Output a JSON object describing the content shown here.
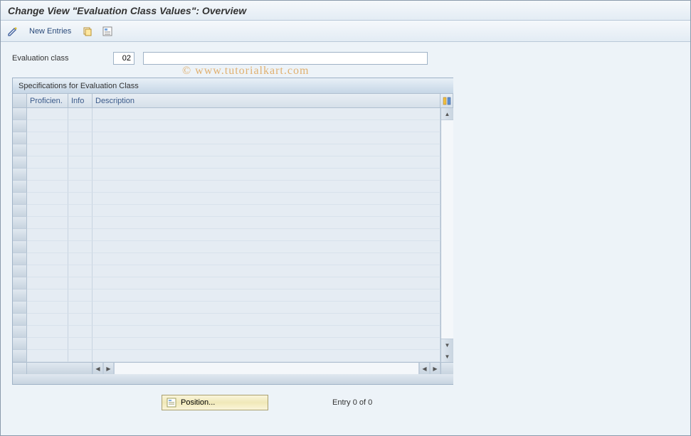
{
  "header": {
    "title": "Change View \"Evaluation Class Values\": Overview"
  },
  "toolbar": {
    "new_entries": "New Entries"
  },
  "field": {
    "label": "Evaluation class",
    "value": "02",
    "desc_value": ""
  },
  "grid": {
    "title": "Specifications for Evaluation Class",
    "headers": {
      "proficien": "Proficien.",
      "info": "Info",
      "description": "Description"
    },
    "row_count": 21
  },
  "footer": {
    "position_label": "Position...",
    "entry_text": "Entry 0 of 0"
  },
  "watermark": "© www.tutorialkart.com"
}
